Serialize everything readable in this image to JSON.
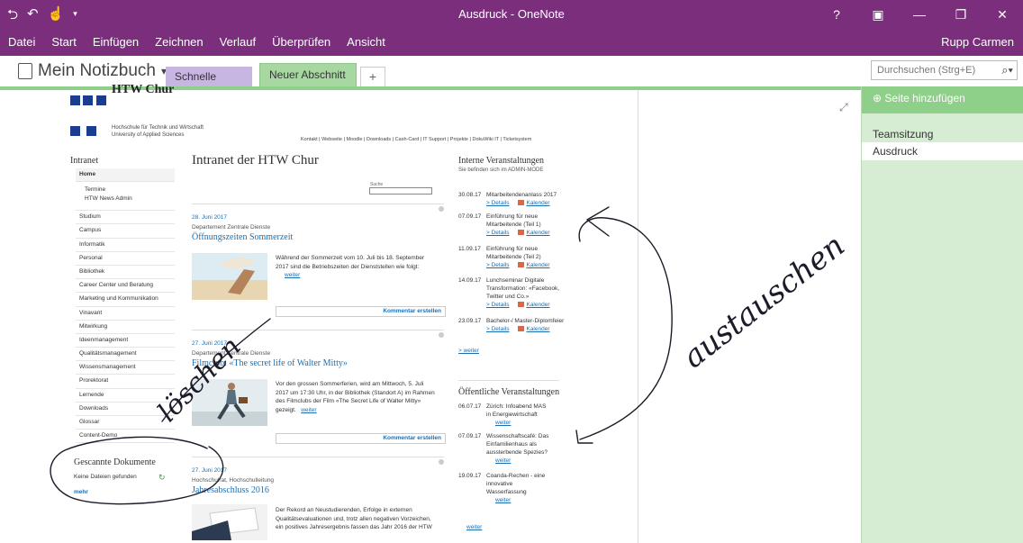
{
  "window": {
    "title": "Ausdruck - OneNote",
    "qat_icons": [
      "back-icon",
      "undo-icon",
      "touch-mode-icon",
      "customize-icon"
    ],
    "controls": [
      "?",
      "ribbon-display-icon",
      "minimize-icon",
      "restore-icon",
      "close-icon"
    ]
  },
  "menu": {
    "items": [
      "Datei",
      "Start",
      "Einfügen",
      "Zeichnen",
      "Verlauf",
      "Überprüfen",
      "Ansicht"
    ],
    "user": "Rupp Carmen"
  },
  "notebook": {
    "name": "Mein Notizbuch",
    "sections": [
      "Schnelle Notizen",
      "Neuer Abschnitt 1"
    ],
    "add_tab": "+"
  },
  "search": {
    "placeholder": "Durchsuchen (Strg+E)"
  },
  "pages_pane": {
    "add_page": "Seite hinzufügen",
    "pages": [
      "Teamsitzung",
      "Ausdruck"
    ]
  },
  "printout": {
    "logo_title": "HTW Chur",
    "logo_sub1": "Hochschule für Technik und Wirtschaft",
    "logo_sub2": "University of Applied Sciences",
    "top_links": "Kontakt | Webseite | Moodle | Downloads | Cash-Card | IT Support | Projekte | DokuWiki IT | Ticketsystem",
    "sidebar": {
      "heading": "Intranet",
      "home": "Home",
      "subitems": [
        "Termine",
        "HTW News Admin"
      ],
      "items": [
        "Studium",
        "Campus",
        "Informatik",
        "Personal",
        "Bibliothek",
        "Career Center und Beratung",
        "Marketing und Kommunikation",
        "Vinavant",
        "Mitwirkung",
        "Ideenmanagement",
        "Qualitätsmanagement",
        "Wissensmanagement",
        "Prorektorat",
        "Lernende",
        "Downloads",
        "Glossar",
        "Content-Demo"
      ]
    },
    "main": {
      "heading": "Intranet der HTW Chur",
      "search_label": "Suche",
      "comment_button": "Kommentar erstellen",
      "news": [
        {
          "date": "28. Juni 2017",
          "dept": "Departement Zentrale Dienste",
          "title": "Öffnungszeiten Sommerzeit",
          "text1": "Während der Sommerzeit vom 10. Juli bis 18. September",
          "text2": "2017 sind die Betriebszeiten der Dienststellen wie folgt:",
          "more": "weiter"
        },
        {
          "date": "27. Juni 2017",
          "dept": "Departement Zentrale Dienste",
          "title": "Filmclub: «The secret life of Walter Mitty»",
          "text1": "Vor den grossen Sommerferien, wird am Mittwoch, 5. Juli",
          "text2": "2017 um 17:30 Uhr, in der Bibliothek (Standort A) im Rahmen",
          "text3": "des Filmclubs der Film «The Secret Life of Walter Mitty»",
          "text4": "gezeigt.",
          "more": "weiter"
        },
        {
          "date": "27. Juni 2017",
          "dept": "Hochschulrat, Hochschulleitung",
          "title": "Jahresabschluss 2016",
          "text1": "Der Rekord an Neustudierenden, Erfolge in externen",
          "text2": "Qualitätsevaluationen und, trotz allen negativen Vorzeichen,",
          "text3": "ein positives Jahresergebnis fassen das Jahr 2016 der HTW"
        }
      ]
    },
    "internal_events": {
      "heading": "Interne Veranstaltungen",
      "sub": "Sie befinden sich im ADMIN-MODE",
      "details": "> Details",
      "calendar": "Kalender",
      "more": "> weiter",
      "events": [
        {
          "date": "30.08.17",
          "lines": [
            "Mitarbeitendenanlass 2017"
          ]
        },
        {
          "date": "07.09.17",
          "lines": [
            "Einführung für neue",
            "Mitarbeitende (Teil 1)"
          ]
        },
        {
          "date": "11.09.17",
          "lines": [
            "Einführung für neue",
            "Mitarbeitende (Teil 2)"
          ]
        },
        {
          "date": "14.09.17",
          "lines": [
            "Lunchseminar Digitale",
            "Transformation: «Facebook,",
            "Twitter und Co.»"
          ]
        },
        {
          "date": "23.09.17",
          "lines": [
            "Bachelor-/ Master-Diplomfeier"
          ]
        }
      ]
    },
    "public_events": {
      "heading": "Öffentliche Veranstaltungen",
      "more": "weiter",
      "events": [
        {
          "date": "06.07.17",
          "lines": [
            "Zürich: Infoabend MAS",
            "in Energiewirtschaft"
          ]
        },
        {
          "date": "07.09.17",
          "lines": [
            "Wissenschaftscafé: Das",
            "Einfamilienhaus als",
            "aussterbende Spezies?"
          ]
        },
        {
          "date": "19.09.17",
          "lines": [
            "Coanda-Rechen - eine",
            "innovative",
            "Wasserfassung"
          ]
        }
      ]
    },
    "scanned": {
      "heading": "Gescannte Dokumente",
      "empty": "Keine Dateien gefunden",
      "more": "mehr"
    }
  },
  "ink": {
    "word1": "austauschen",
    "word2": "löschen"
  }
}
